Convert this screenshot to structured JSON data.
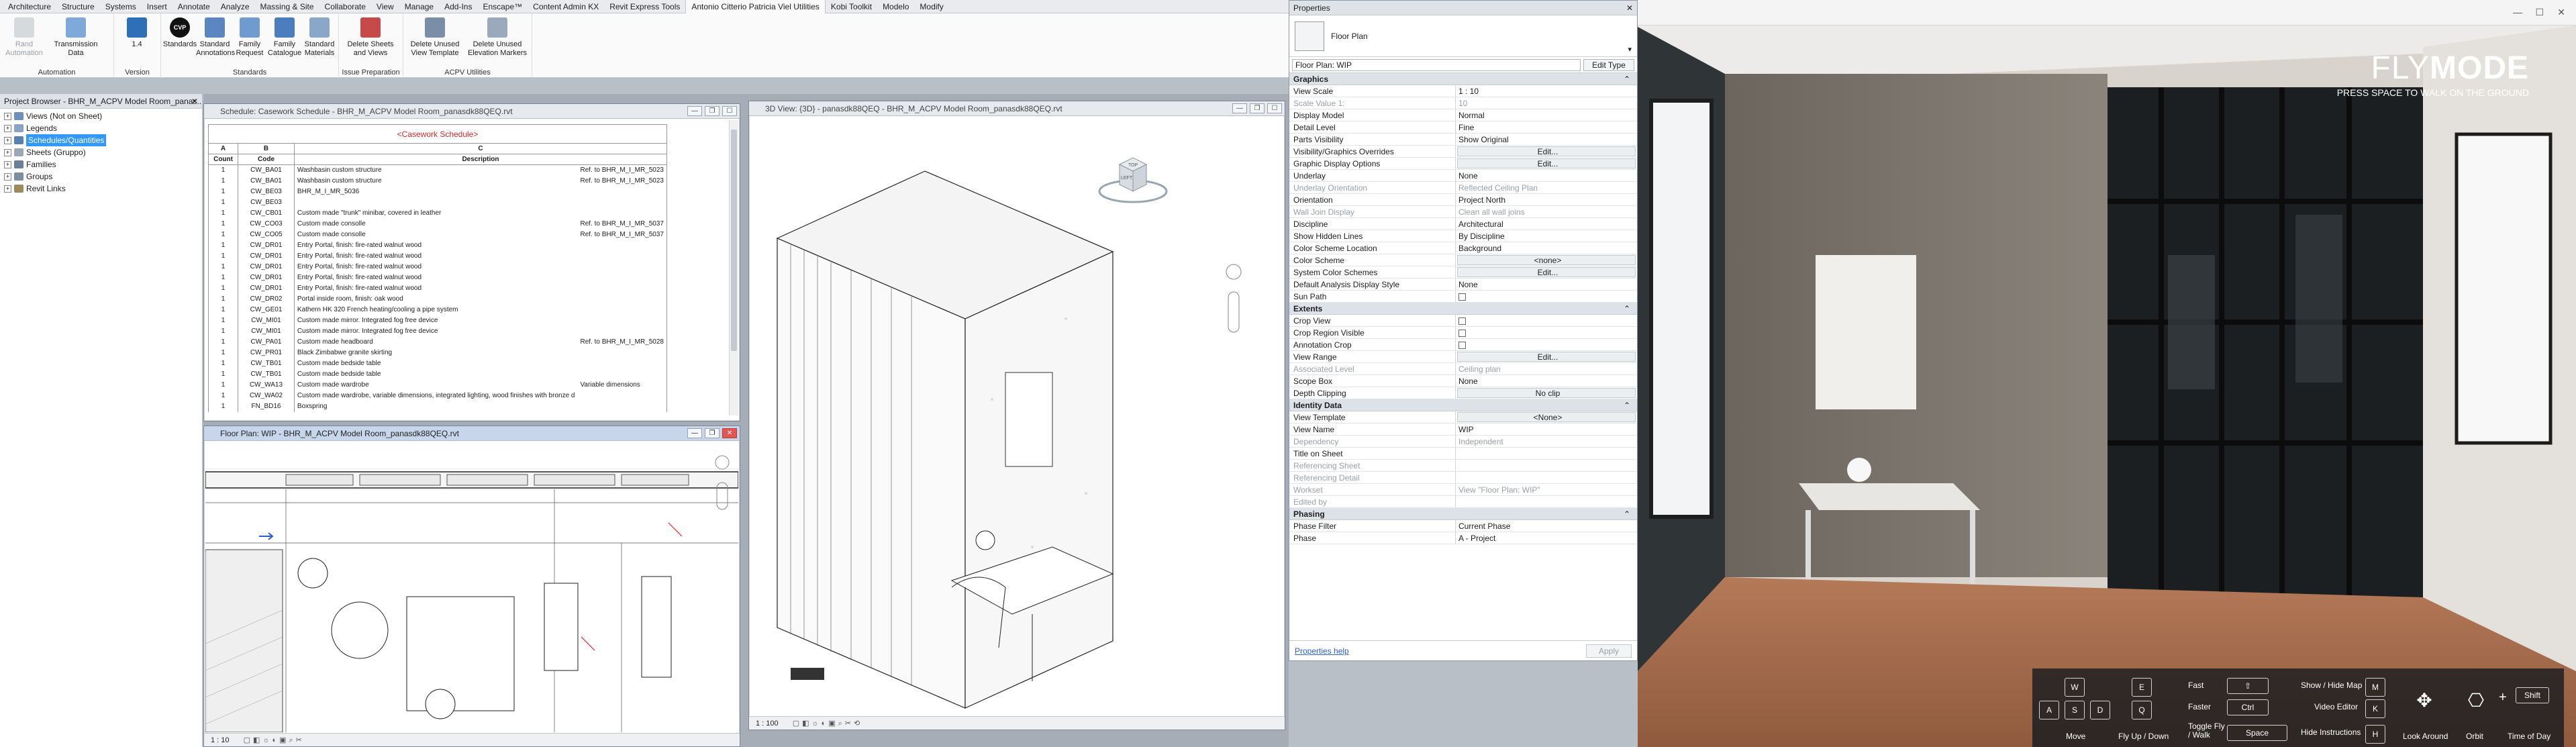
{
  "ribbon": {
    "tabs": [
      "Architecture",
      "Structure",
      "Systems",
      "Insert",
      "Annotate",
      "Analyze",
      "Massing & Site",
      "Collaborate",
      "View",
      "Manage",
      "Add-Ins",
      "Enscape™",
      "Content Admin KX",
      "Revit Express Tools",
      "Antonio Citterio Patricia Viel Utilities",
      "Kobi Toolkit",
      "Modelo",
      "Modify"
    ],
    "active_tab": "Antonio Citterio Patricia Viel Utilities",
    "groups": [
      {
        "label": "Automation",
        "buttons": [
          {
            "label": "Rand Automation",
            "disabled": true
          },
          {
            "label": "Transmission Data",
            "disabled": false
          }
        ]
      },
      {
        "label": "Version",
        "buttons": [
          {
            "label": "1.4",
            "disabled": false
          }
        ]
      },
      {
        "label": "Standards",
        "buttons": [
          {
            "label": "Standards"
          },
          {
            "label": "Standard Annotations"
          },
          {
            "label": "Family Request"
          },
          {
            "label": "Family Catalogue"
          },
          {
            "label": "Standard Materials"
          }
        ]
      },
      {
        "label": "Issue Preparation",
        "buttons": [
          {
            "label": "Delete Sheets and Views"
          }
        ]
      },
      {
        "label": "ACPV Utilities",
        "buttons": [
          {
            "label": "Delete Unused View Template"
          },
          {
            "label": "Delete Unused Elevation Markers"
          }
        ]
      }
    ],
    "version_badge": "CVP"
  },
  "project_browser": {
    "title": "Project Browser - BHR_M_ACPV Model Room_panas...",
    "items": [
      {
        "label": "Views (Not on Sheet)",
        "selected": false
      },
      {
        "label": "Legends",
        "selected": false
      },
      {
        "label": "Schedules/Quantities",
        "selected": true
      },
      {
        "label": "Sheets (Gruppo)",
        "selected": false
      },
      {
        "label": "Families",
        "selected": false
      },
      {
        "label": "Groups",
        "selected": false
      },
      {
        "label": "Revit Links",
        "selected": false
      }
    ]
  },
  "schedule": {
    "title": "Schedule: Casework Schedule - BHR_M_ACPV Model Room_panasdk88QEQ.rvt",
    "heading": "<Casework Schedule>",
    "col_letters": [
      "A",
      "B",
      "C"
    ],
    "headers": [
      "Count",
      "Code",
      "Description"
    ],
    "rows": [
      [
        "1",
        "CW_BA01",
        "Washbasin custom structure",
        "Ref. to BHR_M_I_MR_5023"
      ],
      [
        "1",
        "CW_BA01",
        "Washbasin custom structure",
        "Ref. to BHR_M_I_MR_5023"
      ],
      [
        "1",
        "CW_BE03",
        "BHR_M_I_MR_5036",
        ""
      ],
      [
        "1",
        "CW_BE03",
        "",
        ""
      ],
      [
        "1",
        "CW_CB01",
        "Custom made \"trunk\" minibar, covered in leather",
        ""
      ],
      [
        "1",
        "CW_CO03",
        "Custom made consolle",
        "Ref. to BHR_M_I_MR_5037"
      ],
      [
        "1",
        "CW_CO05",
        "Custom made consolle",
        "Ref. to BHR_M_I_MR_5037"
      ],
      [
        "1",
        "CW_DR01",
        "Entry Portal, finish: fire-rated walnut wood",
        ""
      ],
      [
        "1",
        "CW_DR01",
        "Entry Portal, finish: fire-rated walnut wood",
        ""
      ],
      [
        "1",
        "CW_DR01",
        "Entry Portal, finish: fire-rated walnut wood",
        ""
      ],
      [
        "1",
        "CW_DR01",
        "Entry Portal, finish: fire-rated walnut wood",
        ""
      ],
      [
        "1",
        "CW_DR01",
        "Entry Portal, finish: fire-rated walnut wood",
        ""
      ],
      [
        "1",
        "CW_DR02",
        "Portal inside room, finish: oak wood",
        ""
      ],
      [
        "1",
        "CW_GE01",
        "Kathern HK 320 French heating/cooling a pipe system",
        ""
      ],
      [
        "1",
        "CW_MI01",
        "Custom made mirror. Integrated fog free device",
        ""
      ],
      [
        "1",
        "CW_MI01",
        "Custom made mirror. Integrated fog free device",
        ""
      ],
      [
        "1",
        "CW_PA01",
        "Custom made headboard",
        "Ref. to BHR_M_I_MR_5028"
      ],
      [
        "1",
        "CW_PR01",
        "Black Zimbabwe granite skirting",
        ""
      ],
      [
        "1",
        "CW_TB01",
        "Custom made bedside table",
        ""
      ],
      [
        "1",
        "CW_TB01",
        "Custom made bedside table",
        ""
      ],
      [
        "1",
        "CW_WA13",
        "Custom made wardrobe",
        "Variable dimensions"
      ],
      [
        "1",
        "CW_WA02",
        "Custom made wardrobe, variable dimensions, integrated lighting, wood finishes with bronze d",
        ""
      ],
      [
        "1",
        "FN_BD16",
        "Boxspring",
        ""
      ]
    ]
  },
  "floor_plan": {
    "title": "Floor Plan: WIP - BHR_M_ACPV Model Room_panasdk88QEQ.rvt",
    "scale": "1 : 10"
  },
  "view_3d": {
    "title": "3D View: {3D} - panasdk88QEQ - BHR_M_ACPV Model Room_panasdk88QEQ.rvt",
    "scale": "1 : 100",
    "viewcube": [
      "TOP",
      "LEFT"
    ]
  },
  "properties": {
    "title": "Properties",
    "type_name": "Floor Plan",
    "selector": "Floor Plan: WIP",
    "edit_type": "Edit Type",
    "apply": "Apply",
    "help": "Properties help",
    "sections": [
      {
        "name": "Graphics",
        "rows": [
          {
            "k": "View Scale",
            "v": "1 : 10"
          },
          {
            "k": "Scale Value    1:",
            "v": "10",
            "dim": true
          },
          {
            "k": "Display Model",
            "v": "Normal"
          },
          {
            "k": "Detail Level",
            "v": "Fine"
          },
          {
            "k": "Parts Visibility",
            "v": "Show Original"
          },
          {
            "k": "Visibility/Graphics Overrides",
            "v": "Edit...",
            "btn": true
          },
          {
            "k": "Graphic Display Options",
            "v": "Edit...",
            "btn": true
          },
          {
            "k": "Underlay",
            "v": "None"
          },
          {
            "k": "Underlay Orientation",
            "v": "Reflected Ceiling Plan",
            "dim": true
          },
          {
            "k": "Orientation",
            "v": "Project North"
          },
          {
            "k": "Wall Join Display",
            "v": "Clean all wall joins",
            "dim": true
          },
          {
            "k": "Discipline",
            "v": "Architectural"
          },
          {
            "k": "Show Hidden Lines",
            "v": "By Discipline"
          },
          {
            "k": "Color Scheme Location",
            "v": "Background"
          },
          {
            "k": "Color Scheme",
            "v": "<none>",
            "btn": true
          },
          {
            "k": "System Color Schemes",
            "v": "Edit...",
            "btn": true
          },
          {
            "k": "Default Analysis Display Style",
            "v": "None"
          },
          {
            "k": "Sun Path",
            "v": "",
            "check": true
          }
        ]
      },
      {
        "name": "Extents",
        "rows": [
          {
            "k": "Crop View",
            "v": "",
            "check": true
          },
          {
            "k": "Crop Region Visible",
            "v": "",
            "check": true
          },
          {
            "k": "Annotation Crop",
            "v": "",
            "check": true
          },
          {
            "k": "View Range",
            "v": "Edit...",
            "btn": true
          },
          {
            "k": "Associated Level",
            "v": "Ceiling plan",
            "dim": true
          },
          {
            "k": "Scope Box",
            "v": "None"
          },
          {
            "k": "Depth Clipping",
            "v": "No clip",
            "btn": true
          }
        ]
      },
      {
        "name": "Identity Data",
        "rows": [
          {
            "k": "View Template",
            "v": "<None>",
            "btn": true
          },
          {
            "k": "View Name",
            "v": "WIP"
          },
          {
            "k": "Dependency",
            "v": "Independent",
            "dim": true
          },
          {
            "k": "Title on Sheet",
            "v": ""
          },
          {
            "k": "Referencing Sheet",
            "v": "",
            "dim": true
          },
          {
            "k": "Referencing Detail",
            "v": "",
            "dim": true
          },
          {
            "k": "Workset",
            "v": "View \"Floor Plan: WIP\"",
            "dim": true
          },
          {
            "k": "Edited by",
            "v": "",
            "dim": true
          }
        ]
      },
      {
        "name": "Phasing",
        "rows": [
          {
            "k": "Phase Filter",
            "v": "Current Phase"
          },
          {
            "k": "Phase",
            "v": "A - Project"
          }
        ]
      }
    ]
  },
  "flymode": {
    "logo_a": "FLY",
    "logo_b": "MODE",
    "subtitle": "PRESS SPACE TO WALK ON THE GROUND",
    "controls": {
      "move_keys": [
        "W",
        "A",
        "S",
        "D"
      ],
      "move_label": "Move",
      "updown_keys": [
        "E",
        "Q"
      ],
      "updown_label": "Fly Up / Down",
      "fast_label": "Fast",
      "faster_label": "Faster",
      "faster_key": "Ctrl",
      "toggle_label": "Toggle Fly / Walk",
      "toggle_key": "Space",
      "map_label": "Show / Hide Map",
      "map_key": "M",
      "video_label": "Video Editor",
      "video_key": "K",
      "instructions_label": "Hide Instructions",
      "instructions_key": "H",
      "look_label": "Look Around",
      "orbit_label": "Orbit",
      "time_label": "Time of Day",
      "shift_key": "Shift"
    }
  }
}
